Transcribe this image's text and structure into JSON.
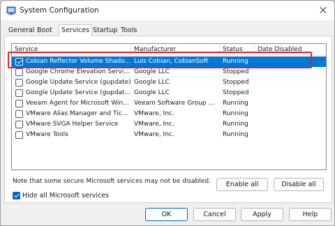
{
  "window": {
    "title": "System Configuration",
    "icon": "system-config-icon",
    "close_icon": "close-icon"
  },
  "tabs": [
    {
      "label": "General",
      "active": false
    },
    {
      "label": "Boot",
      "active": false
    },
    {
      "label": "Services",
      "active": true
    },
    {
      "label": "Startup",
      "active": false
    },
    {
      "label": "Tools",
      "active": false
    }
  ],
  "table": {
    "columns": [
      "Service",
      "Manufacturer",
      "Status",
      "Date Disabled"
    ],
    "rows": [
      {
        "checked": true,
        "selected": true,
        "service": "Cobian Reflector Volume Shado...",
        "manufacturer": "Luis Cobian, CobianSoft",
        "status": "Running",
        "date_disabled": ""
      },
      {
        "checked": false,
        "selected": false,
        "service": "Google Chrome Elevation Servic...",
        "manufacturer": "Google LLC",
        "status": "Stopped",
        "date_disabled": ""
      },
      {
        "checked": false,
        "selected": false,
        "service": "Google Update Service (gupdate)",
        "manufacturer": "Google LLC",
        "status": "Stopped",
        "date_disabled": ""
      },
      {
        "checked": false,
        "selected": false,
        "service": "Google Update Service (gupdatem)",
        "manufacturer": "Google LLC",
        "status": "Stopped",
        "date_disabled": ""
      },
      {
        "checked": false,
        "selected": false,
        "service": "Veeam Agent for Microsoft Wind...",
        "manufacturer": "Veeam Software Group G...",
        "status": "Running",
        "date_disabled": ""
      },
      {
        "checked": false,
        "selected": false,
        "service": "VMware Alias Manager and Ticke...",
        "manufacturer": "VMware, Inc.",
        "status": "Running",
        "date_disabled": ""
      },
      {
        "checked": false,
        "selected": false,
        "service": "VMware SVGA Helper Service",
        "manufacturer": "VMware, Inc.",
        "status": "Running",
        "date_disabled": ""
      },
      {
        "checked": false,
        "selected": false,
        "service": "VMware Tools",
        "manufacturer": "VMware, Inc.",
        "status": "Running",
        "date_disabled": ""
      }
    ]
  },
  "note": "Note that some secure Microsoft services may not be disabled.",
  "enable_all": "Enable all",
  "disable_all": "Disable all",
  "hide_ms": {
    "label": "Hide all Microsoft services",
    "checked": true
  },
  "footer": {
    "ok": "OK",
    "cancel": "Cancel",
    "apply": "Apply",
    "help": "Help"
  },
  "colors": {
    "selection": "#0078d7",
    "highlight_box": "#e0202a",
    "checkbox_accent": "#0067c0"
  }
}
